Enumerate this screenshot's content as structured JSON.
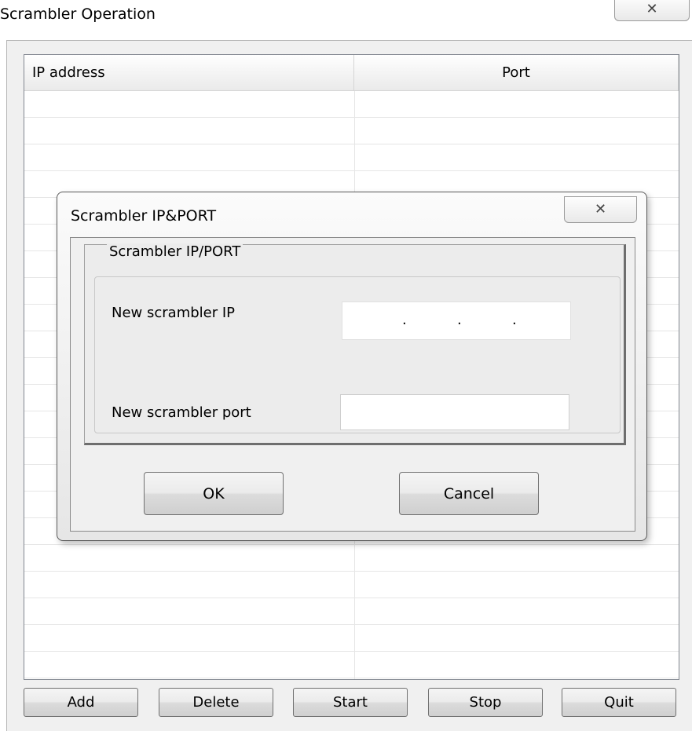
{
  "window": {
    "title": "Scrambler Operation",
    "close_glyph": "✕"
  },
  "table": {
    "columns": [
      "IP address",
      "Port"
    ],
    "rows": []
  },
  "buttons": {
    "add": "Add",
    "delete": "Delete",
    "start": "Start",
    "stop": "Stop",
    "quit": "Quit"
  },
  "dialog": {
    "title": "Scrambler IP&PORT",
    "close_glyph": "✕",
    "group_label": "Scrambler IP/PORT",
    "ip_label": "New scrambler IP",
    "ip_value_separator": ".",
    "port_label": "New scrambler port",
    "port_value": "",
    "ok_label": "OK",
    "cancel_label": "Cancel"
  }
}
